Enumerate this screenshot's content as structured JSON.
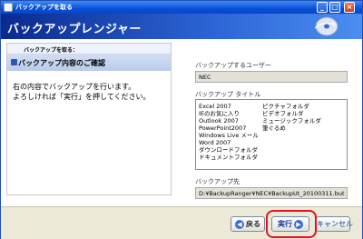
{
  "window": {
    "title": "バックアップを取る"
  },
  "header": {
    "title": "バックアップレンジャー"
  },
  "step": {
    "label": "バックアップを取る：",
    "title": "バックアップ内容のご確認"
  },
  "message": {
    "line1": "右の内容でバックアップを行います。",
    "line2": "よろしければ「実行」を押してください。"
  },
  "backup_user": {
    "label": "バックアップするユーザー",
    "value": "NEC"
  },
  "backup_titles": {
    "label": "バックアップ タイトル",
    "column1": [
      "Excel 2007",
      "IEのお気に入り",
      "Outlook 2007",
      "PowerPoint2007",
      "Windows Live メール",
      "Word 2007",
      "ダウンロードフォルダ",
      "ドキュメントフォルダ"
    ],
    "column2": [
      "ピクチャフォルダ",
      "ビデオフォルダ",
      "ミュージックフォルダ",
      "筆ぐるめ"
    ]
  },
  "backup_destination": {
    "label": "バックアップ先",
    "value": "D:¥BackupRanger¥NEC¥BackupUt_20100311.but"
  },
  "buttons": {
    "back": "戻る",
    "execute": "実行",
    "cancel": "キャンセル"
  },
  "icons": {
    "back": "back-arrow-icon",
    "execute": "execute-arrow-icon"
  },
  "colors": {
    "highlight": "#e0141e",
    "header": "#1a3fae"
  }
}
